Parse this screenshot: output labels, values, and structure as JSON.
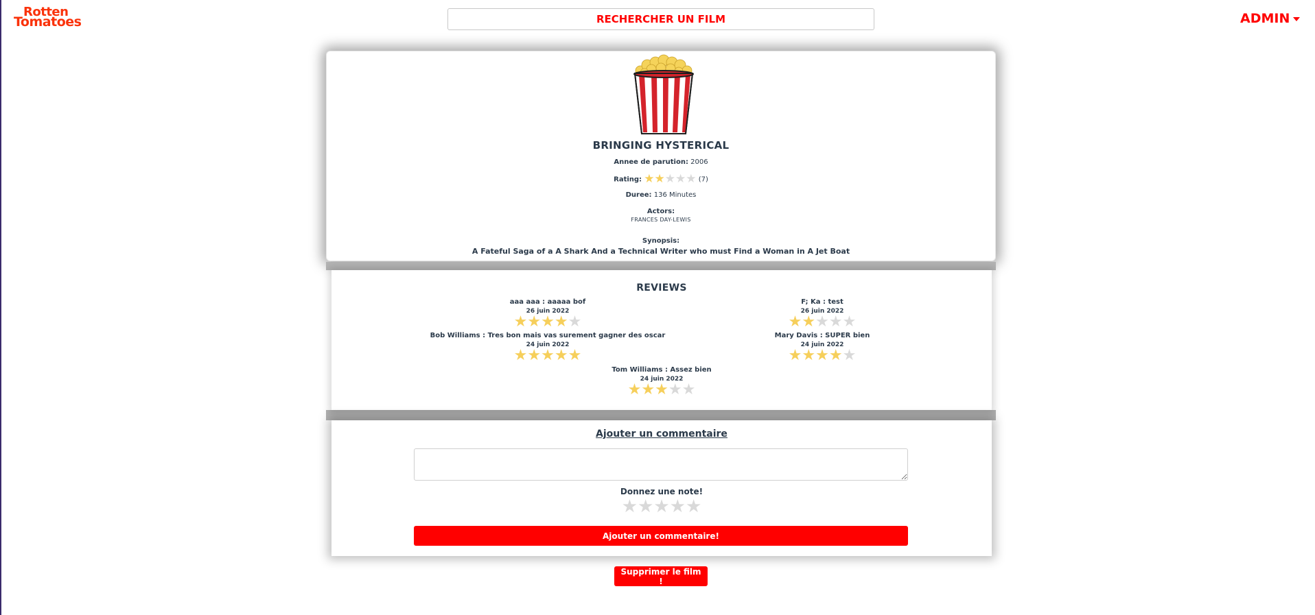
{
  "header": {
    "logo": {
      "line1": "Rotten",
      "line2": "Tomatoes"
    },
    "search_placeholder": "RECHERCHER UN FILM",
    "user_menu": "ADMIN"
  },
  "colors": {
    "accent": "#ff0000",
    "star_on": "#f6cf5b",
    "star_off": "#d9d9d9",
    "text": "#2b3a4a"
  },
  "film": {
    "image_icon": "popcorn-bucket-icon",
    "title": "BRINGING HYSTERICAL",
    "year_label": "Annee de parution:",
    "year": "2006",
    "rating_label": "Rating:",
    "rating": 2,
    "rating_max": 5,
    "rating_count": "(7)",
    "duration_label": "Duree:",
    "duration": "136 Minutes",
    "actors_label": "Actors:",
    "actors": "FRANCES DAY-LEWIS",
    "synopsis_label": "Synopsis:",
    "synopsis": "A Fateful Saga of a A Shark And a Technical Writer who must Find a Woman in A Jet Boat"
  },
  "reviews": {
    "title": "REVIEWS",
    "items": [
      {
        "text": "aaa aaa : aaaaa bof",
        "date": "26 juin 2022",
        "stars": 4
      },
      {
        "text": "F; Ka : test",
        "date": "26 juin 2022",
        "stars": 2
      },
      {
        "text": "Bob Williams : Tres bon mais vas surement gagner des oscar",
        "date": "24 juin 2022",
        "stars": 5
      },
      {
        "text": "Mary Davis : SUPER bien",
        "date": "24 juin 2022",
        "stars": 4
      },
      {
        "text": "Tom Williams : Assez bien",
        "date": "24 juin 2022",
        "stars": 3
      }
    ]
  },
  "comment_form": {
    "title": "Ajouter un commentaire",
    "textarea_value": "",
    "note_label": "Donnez une note!",
    "note_value": 0,
    "submit_label": "Ajouter un commentaire!"
  },
  "delete_label": "Supprimer le film !"
}
